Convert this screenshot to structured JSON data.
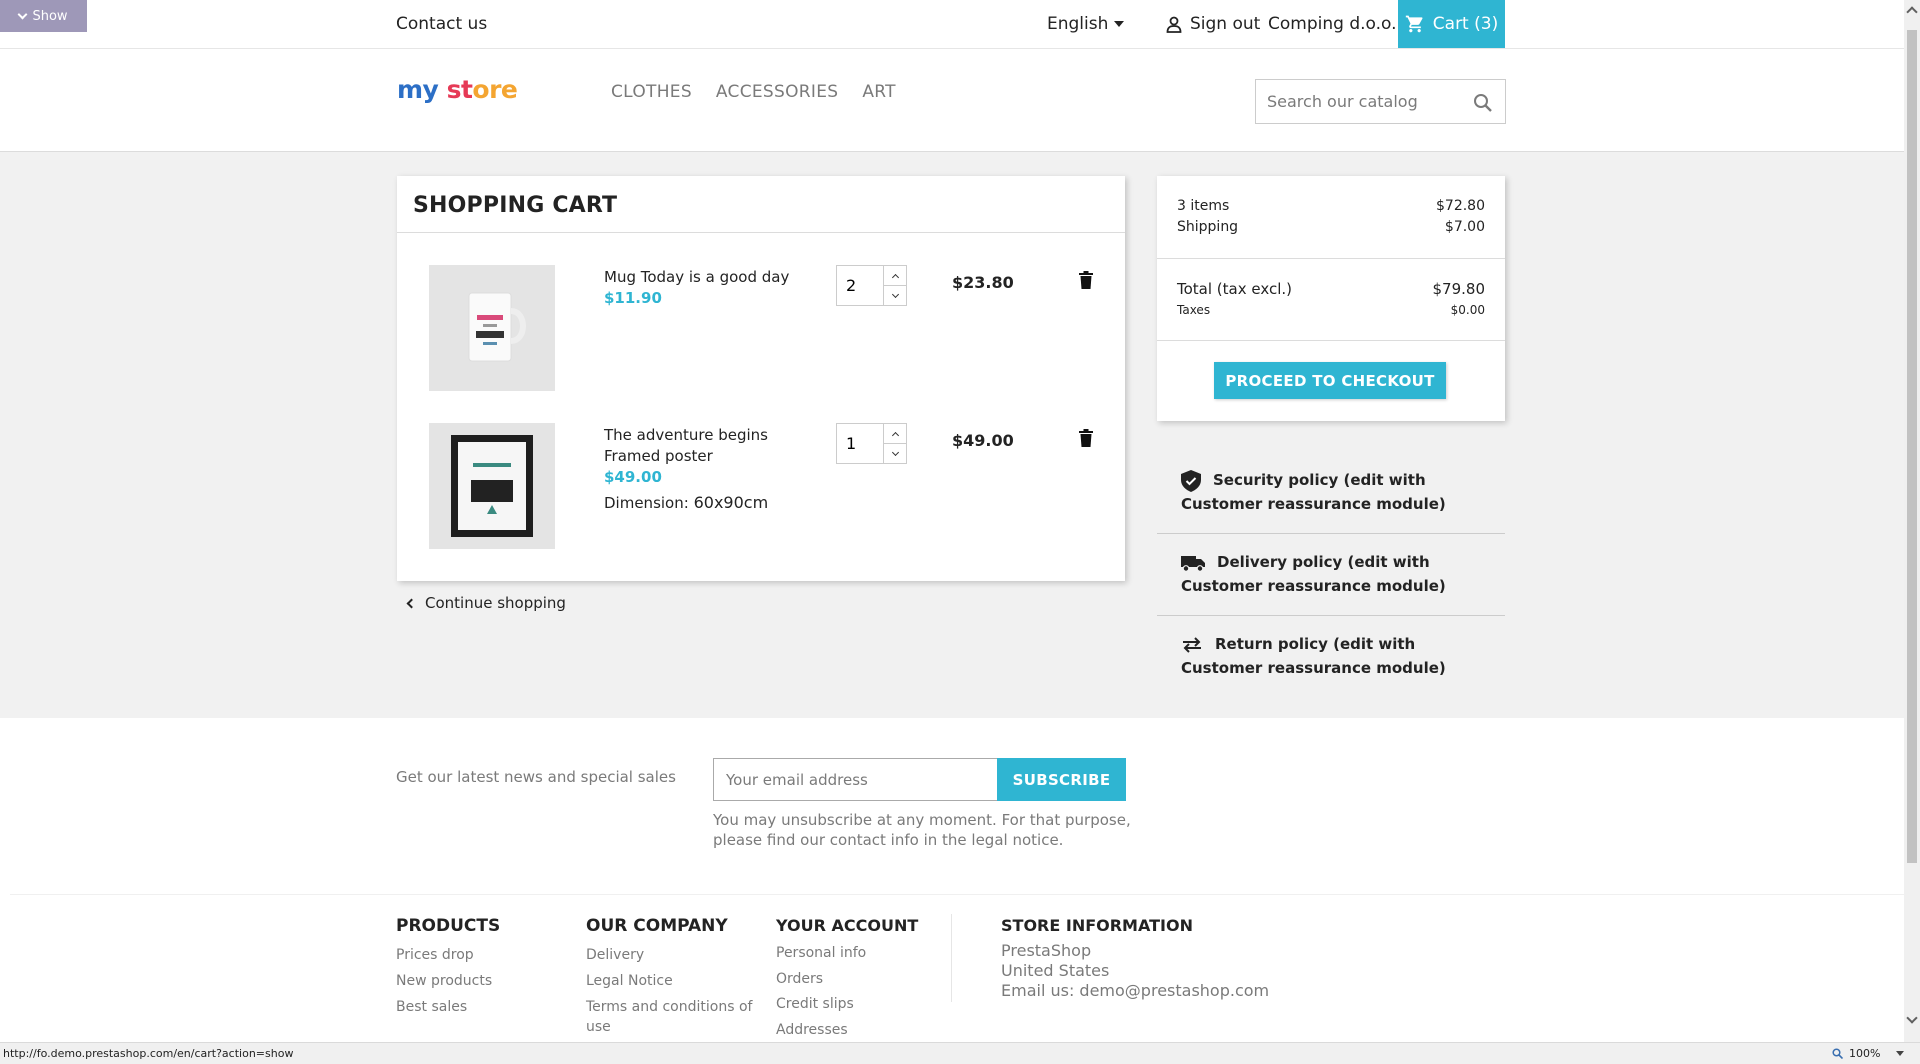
{
  "debug": {
    "show_label": "Show"
  },
  "topbar": {
    "contact": "Contact us",
    "language": "English",
    "signout": "Sign out",
    "company": "Comping d.o.o.",
    "cart": "Cart (3)"
  },
  "header": {
    "logo": {
      "part1": "my ",
      "part2": "st",
      "part3": "ore"
    },
    "nav": [
      "CLOTHES",
      "ACCESSORIES",
      "ART"
    ],
    "search_placeholder": "Search our catalog"
  },
  "cart": {
    "title": "SHOPPING CART",
    "items": [
      {
        "name": "Mug Today is a good day",
        "price": "$11.90",
        "attr_label": "",
        "attr_value": "",
        "qty": "2",
        "total": "$23.80"
      },
      {
        "name": "The adventure begins Framed poster",
        "price": "$49.00",
        "attr_label": "Dimension:",
        "attr_value": "60x90cm",
        "qty": "1",
        "total": "$49.00"
      }
    ],
    "continue": "Continue shopping"
  },
  "summary": {
    "items_label": "3 items",
    "items_value": "$72.80",
    "shipping_label": "Shipping",
    "shipping_value": "$7.00",
    "total_label": "Total (tax excl.)",
    "total_value": "$79.80",
    "taxes_label": "Taxes",
    "taxes_value": "$0.00",
    "checkout": "PROCEED TO CHECKOUT"
  },
  "reassurance": [
    "Security policy (edit with Customer reassurance module)",
    "Delivery policy (edit with Customer reassurance module)",
    "Return policy (edit with Customer reassurance module)"
  ],
  "newsletter": {
    "text": "Get our latest news and special sales",
    "placeholder": "Your email address",
    "button": "SUBSCRIBE",
    "note": "You may unsubscribe at any moment. For that purpose, please find our contact info in the legal notice."
  },
  "footer": {
    "products": {
      "title": "PRODUCTS",
      "links": [
        "Prices drop",
        "New products",
        "Best sales"
      ]
    },
    "company": {
      "title": "OUR COMPANY",
      "links": [
        "Delivery",
        "Legal Notice",
        "Terms and conditions of use"
      ]
    },
    "account": {
      "title": "YOUR ACCOUNT",
      "links": [
        "Personal info",
        "Orders",
        "Credit slips",
        "Addresses"
      ]
    },
    "store": {
      "title": "STORE INFORMATION",
      "lines": [
        "PrestaShop",
        "United States",
        "Email us: demo@prestashop.com"
      ]
    }
  },
  "statusbar": {
    "url": "http://fo.demo.prestashop.com/en/cart?action=show",
    "zoom": "100%"
  },
  "colors": {
    "accent": "#2fb5d2",
    "background": "#f1f1f1",
    "text": "#232323",
    "muted": "#7a7a7a"
  }
}
